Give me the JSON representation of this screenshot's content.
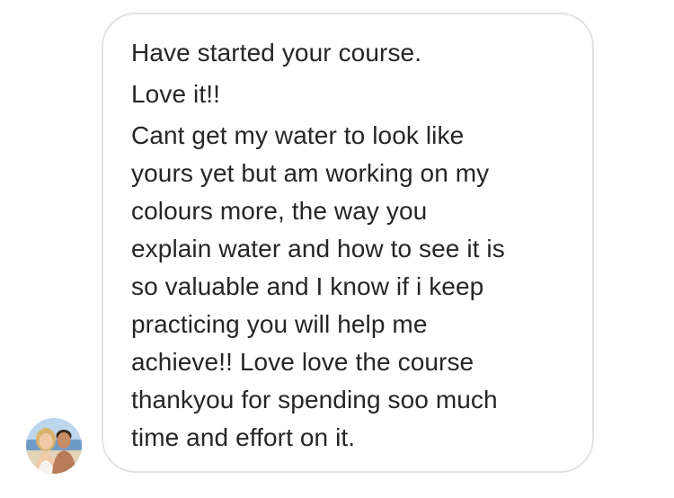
{
  "message": {
    "lines": [
      "Have started your course.",
      "Love it!!",
      "Cant get my water to look like",
      "yours yet but am working on my",
      "colours more, the way you",
      "explain water and how to see it is",
      "so valuable and I know if i keep",
      "practicing you will help me",
      "achieve!! Love love the course",
      "thankyou for spending soo much",
      "time and effort on it."
    ]
  },
  "sender": {
    "avatar_icon": "profile-photo-couple-beach"
  },
  "colors": {
    "text": "#262626",
    "bubble_border": "#e3e3e6",
    "background": "#ffffff"
  }
}
